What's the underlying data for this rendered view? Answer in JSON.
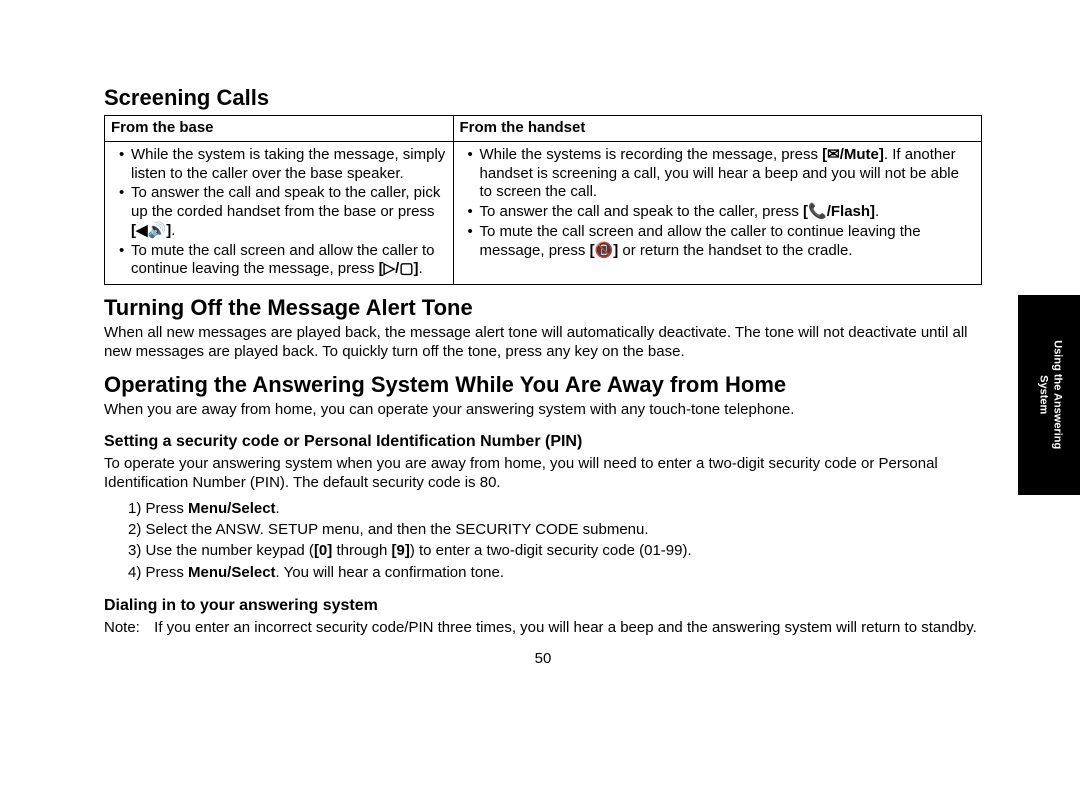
{
  "headings": {
    "screening": "Screening Calls",
    "turning_off": "Turning Off the Message Alert Tone",
    "operating": "Operating the Answering System While You Are Away from Home",
    "setting_pin": "Setting a security code or Personal Identification Number (PIN)",
    "dialing": "Dialing in to your answering system"
  },
  "table": {
    "col1_header": "From the base",
    "col2_header": "From the handset",
    "base": {
      "b1": "While the system is taking the message, simply listen to the caller over the base speaker.",
      "b2_pre": "To answer the call and speak to the caller, pick up the corded handset from the base or press ",
      "b2_key": "[◀🔊]",
      "b2_post": ".",
      "b3_pre": "To mute the call screen and allow the caller to continue leaving the message, press ",
      "b3_key": "[▷/▢]",
      "b3_post": "."
    },
    "handset": {
      "h1_pre": "While the systems is recording the message, press ",
      "h1_key": "[✉/Mute]",
      "h1_post": ". If another handset is screening a call, you will hear a beep and you will not be able to screen the call.",
      "h2_pre": "To answer the call and speak to the caller, press ",
      "h2_key": "[📞/Flash]",
      "h2_post": ".",
      "h3_pre": "To mute the call screen and allow the caller to continue leaving the message, press ",
      "h3_key": "[📵]",
      "h3_post": " or return the handset to the cradle."
    }
  },
  "paras": {
    "turning_off": "When all new messages are played back, the message alert tone will automatically deactivate. The tone will not deactivate until all new messages are played back. To quickly turn off the tone, press any key on the base.",
    "operating": "When you are away from home, you can operate your answering system with any touch-tone telephone.",
    "pin_intro": "To operate your answering system when you are away from home, you will need to enter a two-digit security code or Personal Identification Number (PIN). The default security code is 80."
  },
  "steps": {
    "s1_pre": "1) Press ",
    "s1_key": "Menu/Select",
    "s1_post": ".",
    "s2": "2) Select the ANSW. SETUP menu, and then the SECURITY CODE submenu.",
    "s3_pre": "3) Use the number keypad (",
    "s3_key0": "[0]",
    "s3_mid": " through ",
    "s3_key9": "[9]",
    "s3_post": ") to enter a two-digit security code (01-99).",
    "s4_pre": "4) Press ",
    "s4_key": "Menu/Select",
    "s4_post": ". You will hear a confirmation tone."
  },
  "note": {
    "label": "Note:",
    "body": "If you enter an incorrect security code/PIN three times, you will hear a beep and the answering system will return to standby."
  },
  "page_number": "50",
  "sidetab": {
    "line1": "Using the Answering",
    "line2": "System"
  }
}
